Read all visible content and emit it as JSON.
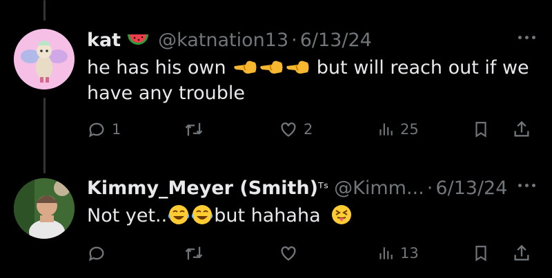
{
  "posts": [
    {
      "name": "kat",
      "name_emoji": "watermelon-emoji",
      "handle": "@katnation13",
      "separator": "·",
      "date": "6/13/24",
      "text_before": "he has his own",
      "inline_emojis": [
        "backhand-index-pointing-left-emoji",
        "backhand-index-pointing-left-emoji",
        "backhand-index-pointing-left-emoji"
      ],
      "text_after": "but will reach out if we have any trouble",
      "reply_count": "1",
      "like_count": "2",
      "view_count": "25"
    },
    {
      "name": "Kimmy_Meyer (Smith)",
      "name_suffix": "ᵀˢ",
      "handle": "@Kimm...",
      "separator": "·",
      "date": "6/13/24",
      "text_before": "Not yet..",
      "inline_emojis": [
        "face-with-tears-of-joy-emoji",
        "face-with-tears-of-joy-emoji"
      ],
      "text_after": "but hahaha",
      "trailing_emoji": "squinting-face-with-tongue-emoji",
      "reply_count": "",
      "like_count": "",
      "view_count": "13"
    }
  ],
  "colors": {
    "background": "#000000",
    "text_primary": "#e7e9ea",
    "text_secondary": "#71767b",
    "thread_line": "#333639"
  }
}
